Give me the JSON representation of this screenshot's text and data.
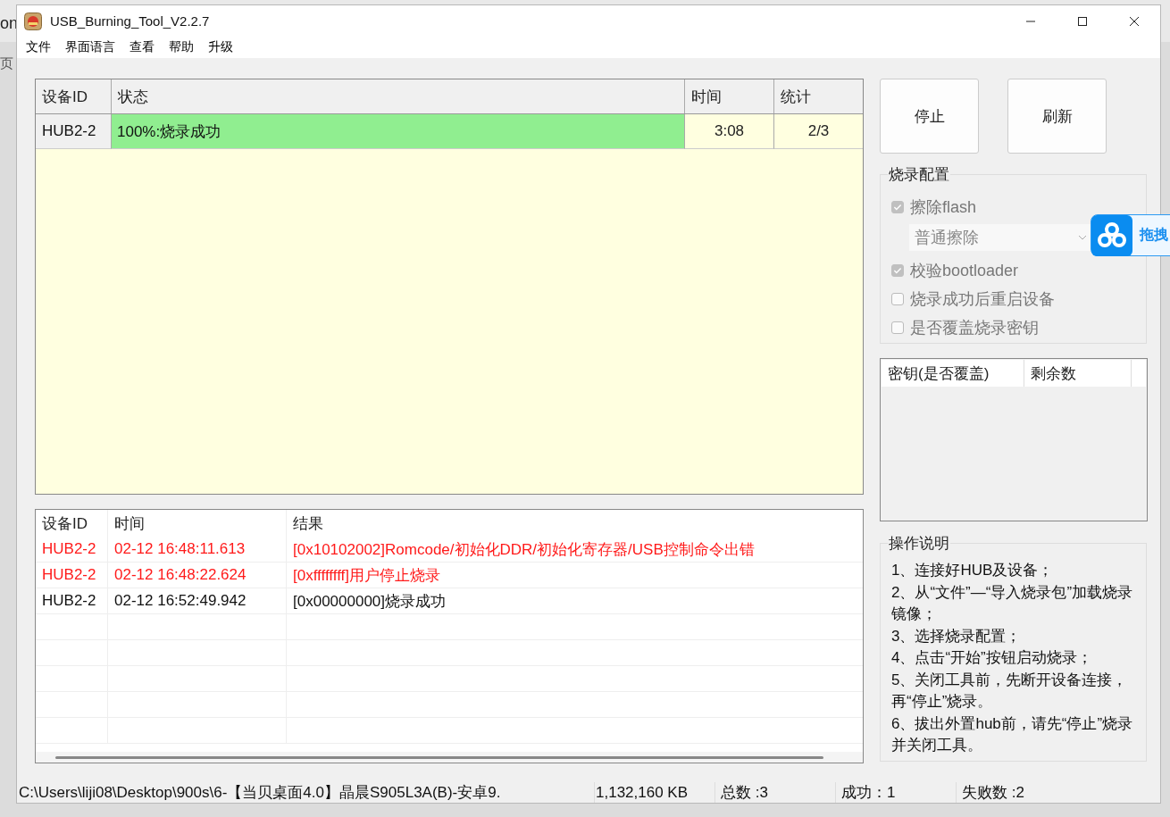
{
  "desktop": {
    "texts": [
      "on",
      "页"
    ]
  },
  "window": {
    "title": "USB_Burning_Tool_V2.2.7"
  },
  "menu": [
    "文件",
    "界面语言",
    "查看",
    "帮助",
    "升级"
  ],
  "device_table": {
    "columns": [
      "设备ID",
      "状态",
      "时间",
      "统计"
    ],
    "rows": [
      {
        "device_id": "HUB2-2",
        "status": "100%:烧录成功",
        "level": 1,
        "time": "3:08",
        "count": "2/3"
      }
    ]
  },
  "buttons": [
    "停止",
    "刷新"
  ],
  "burn_config": {
    "title": "烧录配置",
    "options": [
      {
        "kind": "checkbox",
        "label": "擦除flash",
        "checked": true,
        "disabled": true
      },
      {
        "kind": "select",
        "value": "普通擦除",
        "disabled": true
      },
      {
        "kind": "checkbox",
        "label": "校验bootloader",
        "checked": true,
        "disabled": true
      },
      {
        "kind": "checkbox",
        "label": "烧录成功后重启设备",
        "checked": false,
        "disabled": true
      },
      {
        "kind": "checkbox",
        "label": "是否覆盖烧录密钥",
        "checked": false,
        "disabled": true
      }
    ]
  },
  "key_table": {
    "columns": [
      "密钥(是否覆盖)",
      "剩余数"
    ]
  },
  "log_table": {
    "columns": [
      "设备ID",
      "时间",
      "结果"
    ],
    "rows": [
      {
        "device_id": "HUB2-2",
        "time": "02-12 16:48:11.613",
        "result": "[0x10102002]Romcode/初始化DDR/初始化寄存器/USB控制命令出错",
        "error": true
      },
      {
        "device_id": "HUB2-2",
        "time": "02-12 16:48:22.624",
        "result": "[0xffffffff]用户停止烧录",
        "error": true
      },
      {
        "device_id": "HUB2-2",
        "time": "02-12 16:52:49.942",
        "result": "[0x00000000]烧录成功",
        "error": false
      }
    ]
  },
  "instructions": {
    "title": "操作说明",
    "items": [
      "1、连接好HUB及设备；",
      "2、从“文件”—“导入烧录包”加载烧录镜像；",
      "3、选择烧录配置；",
      "4、点击“开始”按钮启动烧录；",
      "5、关闭工具前，先断开设备连接，再“停止”烧录。",
      "6、拔出外置hub前，请先“停止”烧录并关闭工具。"
    ]
  },
  "status_bar": [
    "C:\\Users\\liji08\\Desktop\\900s\\6-【当贝桌面4.0】晶晨S905L3A(B)-安卓9.",
    "1,132,160 KB",
    "总数 :3",
    "成功：1",
    "失败数 :2"
  ],
  "drag_widget": {
    "label": "拖拽"
  }
}
